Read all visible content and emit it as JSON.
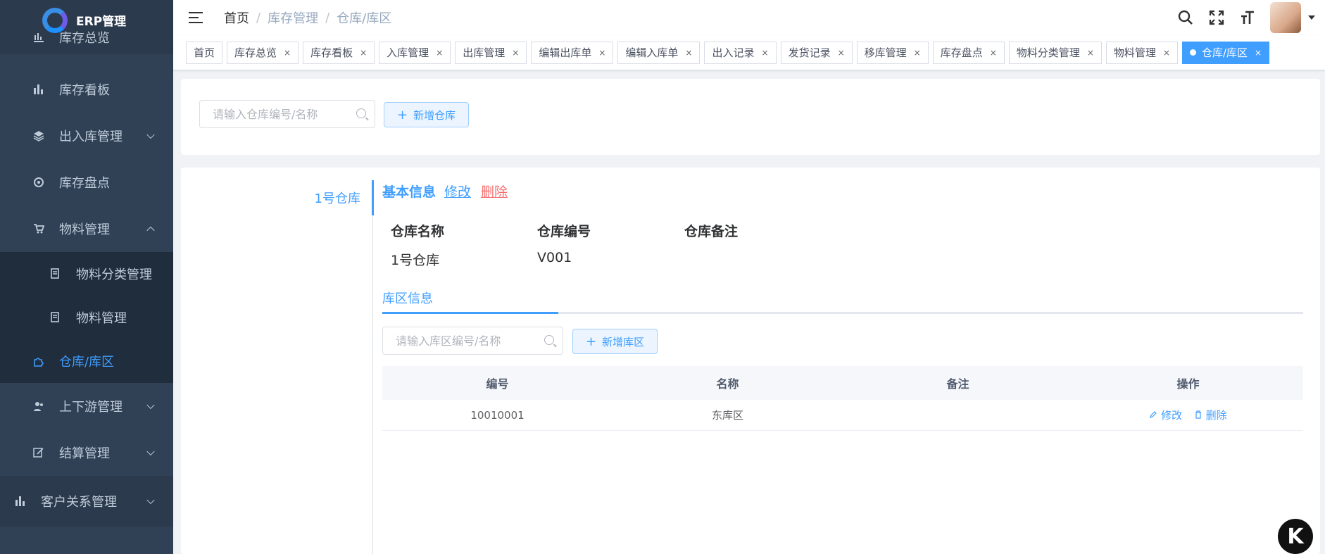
{
  "app": {
    "title": "ERP管理"
  },
  "sidebar": {
    "items": [
      {
        "label": "库存总览"
      },
      {
        "label": "库存看板"
      },
      {
        "label": "出入库管理"
      },
      {
        "label": "库存盘点"
      },
      {
        "label": "物料管理"
      },
      {
        "label": "物料分类管理"
      },
      {
        "label": "物料管理"
      },
      {
        "label": "仓库/库区"
      },
      {
        "label": "上下游管理"
      },
      {
        "label": "结算管理"
      },
      {
        "label": "客户关系管理"
      }
    ]
  },
  "header": {
    "breadcrumb": [
      "首页",
      "库存管理",
      "仓库/库区"
    ]
  },
  "tags": [
    {
      "label": "首页"
    },
    {
      "label": "库存总览"
    },
    {
      "label": "库存看板"
    },
    {
      "label": "入库管理"
    },
    {
      "label": "出库管理"
    },
    {
      "label": "编辑出库单"
    },
    {
      "label": "编辑入库单"
    },
    {
      "label": "出入记录"
    },
    {
      "label": "发货记录"
    },
    {
      "label": "移库管理"
    },
    {
      "label": "库存盘点"
    },
    {
      "label": "物料分类管理"
    },
    {
      "label": "物料管理"
    },
    {
      "label": "仓库/库区"
    }
  ],
  "warehouse_search": {
    "placeholder": "请输入仓库编号/名称",
    "add_label": "新增仓库"
  },
  "warehouses": [
    {
      "name": "1号仓库"
    }
  ],
  "detail": {
    "title": "基本信息",
    "edit_label": "修改",
    "delete_label": "删除",
    "fields": {
      "name_label": "仓库名称",
      "name_value": "1号仓库",
      "code_label": "仓库编号",
      "code_value": "V001",
      "remark_label": "仓库备注",
      "remark_value": ""
    },
    "tab_label": "库区信息",
    "zone_search": {
      "placeholder": "请输入库区编号/名称",
      "add_label": "新增库区"
    },
    "table": {
      "headers": [
        "编号",
        "名称",
        "备注",
        "操作"
      ],
      "rows": [
        {
          "code": "10010001",
          "name": "东库区",
          "remark": "",
          "edit": "修改",
          "delete": "删除"
        }
      ]
    }
  },
  "badge": {
    "text": "K"
  },
  "colors": {
    "primary": "#409eff",
    "sidebar": "#304156",
    "danger": "#f56c6c"
  }
}
